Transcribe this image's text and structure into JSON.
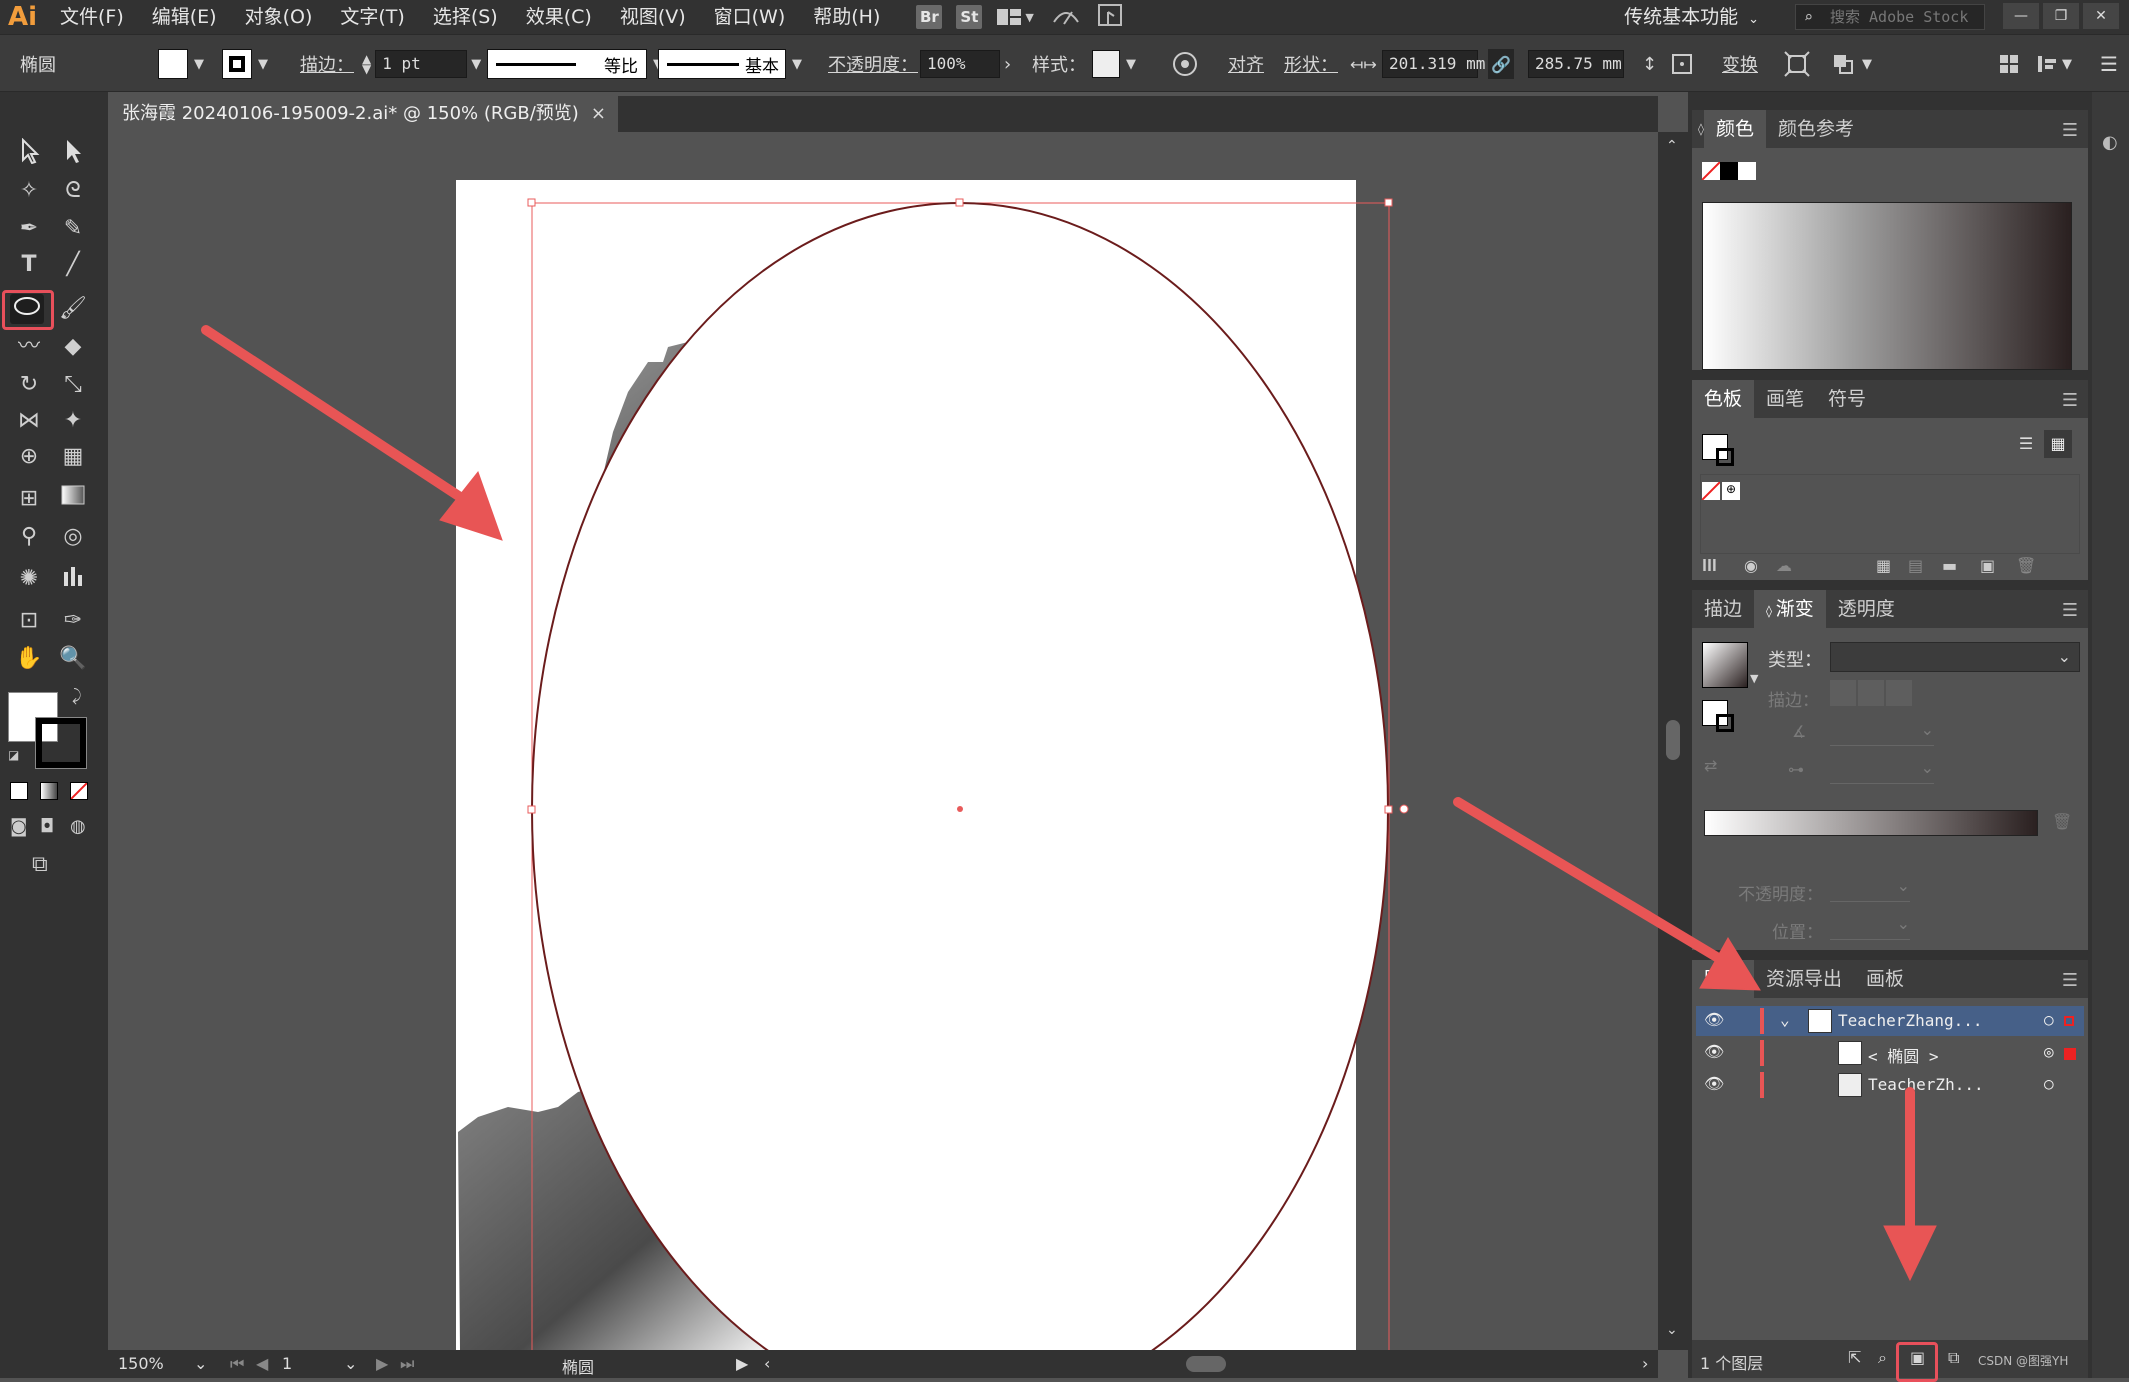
{
  "app": {
    "logo": "Ai"
  },
  "menu": [
    "文件(F)",
    "编辑(E)",
    "对象(O)",
    "文字(T)",
    "选择(S)",
    "效果(C)",
    "视图(V)",
    "窗口(W)",
    "帮助(H)"
  ],
  "badges": [
    "Br",
    "St"
  ],
  "workspace": "传统基本功能",
  "stock_search_placeholder": "搜索 Adobe Stock",
  "control": {
    "object_label": "椭圆",
    "stroke_label": "描边：",
    "stroke_value": "1 pt",
    "profile_label": "等比",
    "brush_label": "基本",
    "opacity_label": "不透明度：",
    "opacity_value": "100%",
    "style_label": "样式：",
    "align_label": "对齐",
    "shape_label": "形状：",
    "width_value": "201.319 mm",
    "height_value": "285.75 mm",
    "transform_label": "变换"
  },
  "document": {
    "tab_title": "张海霞 20240106-195009-2.ai* @ 150% (RGB/预览)"
  },
  "status": {
    "zoom": "150%",
    "artboard": "1",
    "tool_name": "椭圆"
  },
  "panels": {
    "color": {
      "tabs": [
        "颜色",
        "颜色参考"
      ]
    },
    "swatches": {
      "tabs": [
        "色板",
        "画笔",
        "符号"
      ]
    },
    "gradient": {
      "tabs": [
        "描边",
        "渐变",
        "透明度"
      ],
      "type_label": "类型：",
      "stroke_label": "描边：",
      "opacity_label": "不透明度：",
      "position_label": "位置："
    },
    "layers": {
      "tabs": [
        "图层",
        "资源导出",
        "画板"
      ],
      "rows": [
        {
          "name": "TeacherZhang..."
        },
        {
          "name": "< 椭圆 >"
        },
        {
          "name": "TeacherZh..."
        }
      ],
      "footer_count": "1 个图层",
      "watermark": "CSDN @图强YH"
    }
  },
  "colors": {
    "accent_red": "#e85555",
    "selection": "#e85b5b"
  }
}
